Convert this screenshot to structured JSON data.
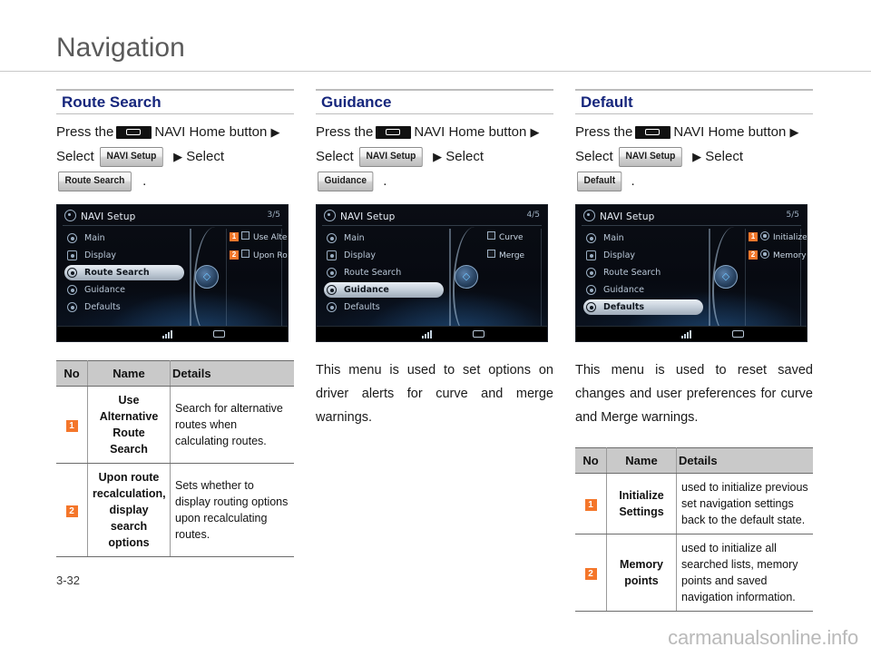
{
  "page": {
    "title": "Navigation",
    "folio": "3-32",
    "watermark": "carmanualsonline.info"
  },
  "common": {
    "press_the": "Press the",
    "navi_home_button": "NAVI Home button",
    "select": "Select",
    "arrow": "▶",
    "period": ".",
    "navi_setup_chip": "NAVI Setup",
    "hw_button_icon": "navi-home-hardware-button-icon"
  },
  "table_headers": {
    "no": "No",
    "name": "Name",
    "details": "Details"
  },
  "sections": [
    {
      "id": "route-search",
      "title": "Route Search",
      "final_chip": "Route Search",
      "screenshot": {
        "title": "NAVI Setup",
        "page_indicator": "3/5",
        "menu": [
          {
            "label": "Main",
            "icon": "gear-icon",
            "selected": false
          },
          {
            "label": "Display",
            "icon": "display-icon",
            "selected": false
          },
          {
            "label": "Route Search",
            "icon": "search-icon",
            "selected": true
          },
          {
            "label": "Guidance",
            "icon": "guidance-icon",
            "selected": false
          },
          {
            "label": "Defaults",
            "icon": "defaults-icon",
            "selected": false
          }
        ],
        "options": [
          {
            "badge": "1",
            "type": "checkbox",
            "label": "Use Alternative Rout..."
          },
          {
            "badge": "2",
            "type": "checkbox",
            "label": "Upon Route Recalc..."
          }
        ],
        "knob": "◇"
      },
      "paragraph": "",
      "table": [
        {
          "no": "1",
          "name": "Use Alternative Route Search",
          "details": "Search for alternative routes when calculating routes."
        },
        {
          "no": "2",
          "name": "Upon route recalculation, display search options",
          "details": "Sets whether to display routing options upon recalculating routes."
        }
      ]
    },
    {
      "id": "guidance",
      "title": "Guidance",
      "final_chip": "Guidance",
      "screenshot": {
        "title": "NAVI Setup",
        "page_indicator": "4/5",
        "menu": [
          {
            "label": "Main",
            "icon": "gear-icon",
            "selected": false
          },
          {
            "label": "Display",
            "icon": "display-icon",
            "selected": false
          },
          {
            "label": "Route Search",
            "icon": "search-icon",
            "selected": false
          },
          {
            "label": "Guidance",
            "icon": "guidance-icon",
            "selected": true
          },
          {
            "label": "Defaults",
            "icon": "defaults-icon",
            "selected": false
          }
        ],
        "options": [
          {
            "badge": "",
            "type": "checkbox",
            "label": "Curve"
          },
          {
            "badge": "",
            "type": "checkbox",
            "label": "Merge"
          }
        ],
        "knob": "◇"
      },
      "paragraph": "This menu is used to set options on driver alerts for curve and merge warnings.",
      "table": []
    },
    {
      "id": "default",
      "title": "Default",
      "final_chip": "Default",
      "screenshot": {
        "title": "NAVI Setup",
        "page_indicator": "5/5",
        "menu": [
          {
            "label": "Main",
            "icon": "gear-icon",
            "selected": false
          },
          {
            "label": "Display",
            "icon": "display-icon",
            "selected": false
          },
          {
            "label": "Route Search",
            "icon": "search-icon",
            "selected": false
          },
          {
            "label": "Guidance",
            "icon": "guidance-icon",
            "selected": false
          },
          {
            "label": "Defaults",
            "icon": "defaults-icon",
            "selected": true
          }
        ],
        "options": [
          {
            "badge": "1",
            "type": "icon",
            "label": "Initialize Settings"
          },
          {
            "badge": "2",
            "type": "icon",
            "label": "Memory Points"
          }
        ],
        "knob": "◇"
      },
      "paragraph": "This menu is used to reset saved changes and user preferences for curve and Merge warnings.",
      "table": [
        {
          "no": "1",
          "name": "Initialize Settings",
          "details": "used to initialize previous set navigation settings back to the default state."
        },
        {
          "no": "2",
          "name": "Memory points",
          "details": "used to initialize all searched lists, memory points and saved navigation information."
        }
      ]
    }
  ],
  "colors": {
    "section_title": "#16267c",
    "badge_orange": "#f4762a",
    "heading_gray": "#5a5a5a",
    "table_header_bg": "#c9c9c9"
  }
}
